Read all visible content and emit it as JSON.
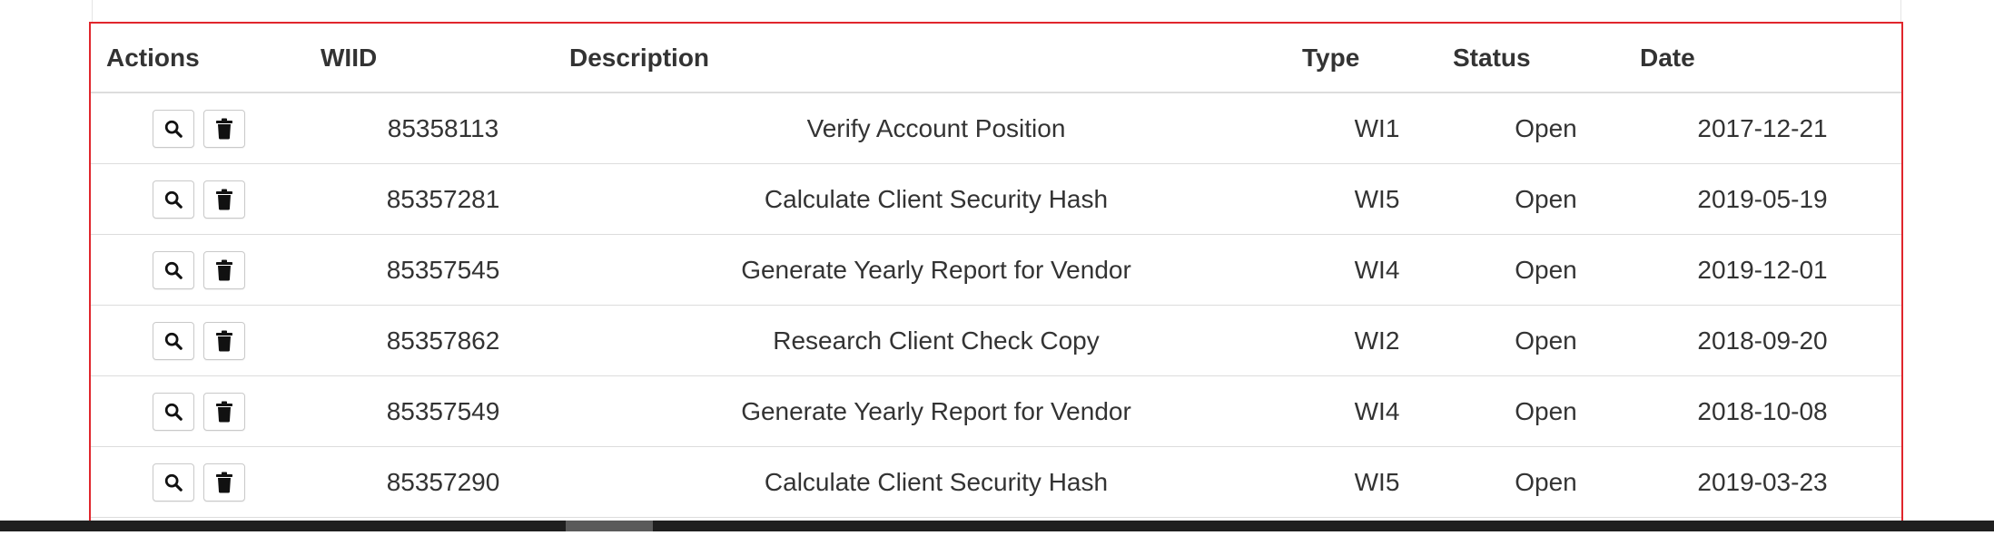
{
  "table": {
    "headers": {
      "actions": "Actions",
      "wiid": "WIID",
      "description": "Description",
      "type": "Type",
      "status": "Status",
      "date": "Date"
    },
    "rows": [
      {
        "wiid": "85358113",
        "description": "Verify Account Position",
        "type": "WI1",
        "status": "Open",
        "date": "2017-12-21"
      },
      {
        "wiid": "85357281",
        "description": "Calculate Client Security Hash",
        "type": "WI5",
        "status": "Open",
        "date": "2019-05-19"
      },
      {
        "wiid": "85357545",
        "description": "Generate Yearly Report for Vendor",
        "type": "WI4",
        "status": "Open",
        "date": "2019-12-01"
      },
      {
        "wiid": "85357862",
        "description": "Research Client Check Copy",
        "type": "WI2",
        "status": "Open",
        "date": "2018-09-20"
      },
      {
        "wiid": "85357549",
        "description": "Generate Yearly Report for Vendor",
        "type": "WI4",
        "status": "Open",
        "date": "2018-10-08"
      },
      {
        "wiid": "85357290",
        "description": "Calculate Client Security Hash",
        "type": "WI5",
        "status": "Open",
        "date": "2019-03-23"
      }
    ],
    "row_actions": [
      "search-icon",
      "trash-icon"
    ]
  },
  "colors": {
    "highlight_border": "#e0262c",
    "row_divider": "#dddddd",
    "text": "#333333",
    "scrollbar_track": "#1f1f1f",
    "scrollbar_thumb": "#5a5a5a"
  }
}
